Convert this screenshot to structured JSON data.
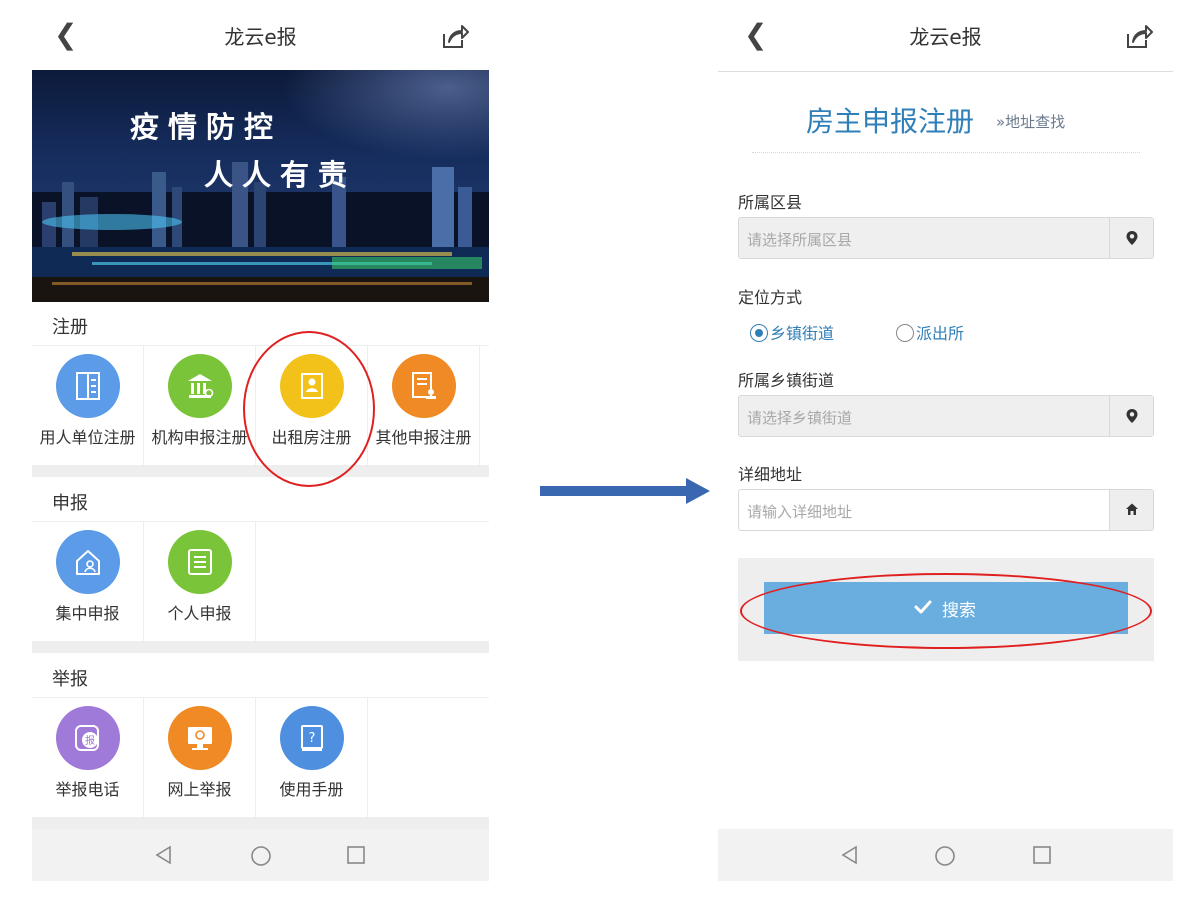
{
  "left_screen": {
    "title": "龙云e报",
    "banner": {
      "slogan_line1": "疫情防控",
      "slogan_line2": "人人有责"
    },
    "sections": [
      {
        "title": "注册",
        "items": [
          {
            "label": "用人单位注册",
            "icon": "building-document-icon",
            "color": "#5b9be8"
          },
          {
            "label": "机构申报注册",
            "icon": "institution-icon",
            "color": "#7ac43a"
          },
          {
            "label": "出租房注册",
            "icon": "id-card-icon",
            "color": "#f2c21a"
          },
          {
            "label": "其他申报注册",
            "icon": "document-stamp-icon",
            "color": "#f08a24"
          }
        ]
      },
      {
        "title": "申报",
        "items": [
          {
            "label": "集中申报",
            "icon": "house-person-icon",
            "color": "#5b9be8"
          },
          {
            "label": "个人申报",
            "icon": "form-list-icon",
            "color": "#7ac43a"
          }
        ]
      },
      {
        "title": "举报",
        "items": [
          {
            "label": "举报电话",
            "icon": "report-phone-icon",
            "color": "#a07ad8"
          },
          {
            "label": "网上举报",
            "icon": "monitor-report-icon",
            "color": "#f08a24"
          },
          {
            "label": "使用手册",
            "icon": "manual-book-icon",
            "color": "#4f8fe0"
          }
        ]
      }
    ]
  },
  "right_screen": {
    "title": "龙云e报",
    "form_title": "房主申报注册",
    "form_subtitle": "»地址查找",
    "fields": {
      "district": {
        "label": "所属区县",
        "placeholder": "请选择所属区县"
      },
      "locate_mode": {
        "label": "定位方式",
        "options": [
          "乡镇街道",
          "派出所"
        ],
        "selected": "乡镇街道"
      },
      "street": {
        "label": "所属乡镇街道",
        "placeholder": "请选择乡镇街道"
      },
      "address": {
        "label": "详细地址",
        "placeholder": "请输入详细地址"
      }
    },
    "search_button": "搜索"
  },
  "colors": {
    "accent_blue": "#2f7fb8",
    "button_blue": "#6aaedf",
    "annotation_red": "#e02020",
    "arrow_blue": "#3a68b0"
  }
}
